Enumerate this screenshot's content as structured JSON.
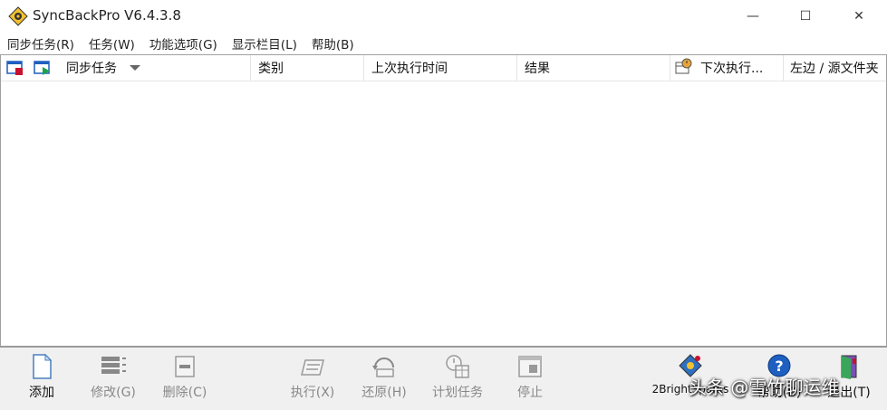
{
  "window": {
    "title": "SyncBackPro V6.4.3.8",
    "min_glyph": "—",
    "max_glyph": "☐",
    "close_glyph": "✕"
  },
  "menu": [
    "同步任务(R)",
    "任务(W)",
    "功能选项(G)",
    "显示栏目(L)",
    "帮助(B)"
  ],
  "columns": {
    "profile": "同步任务",
    "type": "类别",
    "last_run": "上次执行时间",
    "result": "结果",
    "next_run": "下次执行...",
    "left_source": "左边 / 源文件夹"
  },
  "scroll": {
    "left": "<",
    "right": ">"
  },
  "toolbar": {
    "add": "添加",
    "modify": "修改(G)",
    "delete": "删除(C)",
    "run": "执行(X)",
    "restore": "还原(H)",
    "schedule": "计划任务",
    "stop": "停止",
    "brand": "2BrightSparks",
    "help": "帮助(B)",
    "exit": "退出(T)"
  },
  "watermark": "头条 @雪竹聊运维",
  "colors": {
    "accent_red": "#c8102e",
    "accent_green": "#1aa34a",
    "help_blue": "#1f5fbf"
  }
}
